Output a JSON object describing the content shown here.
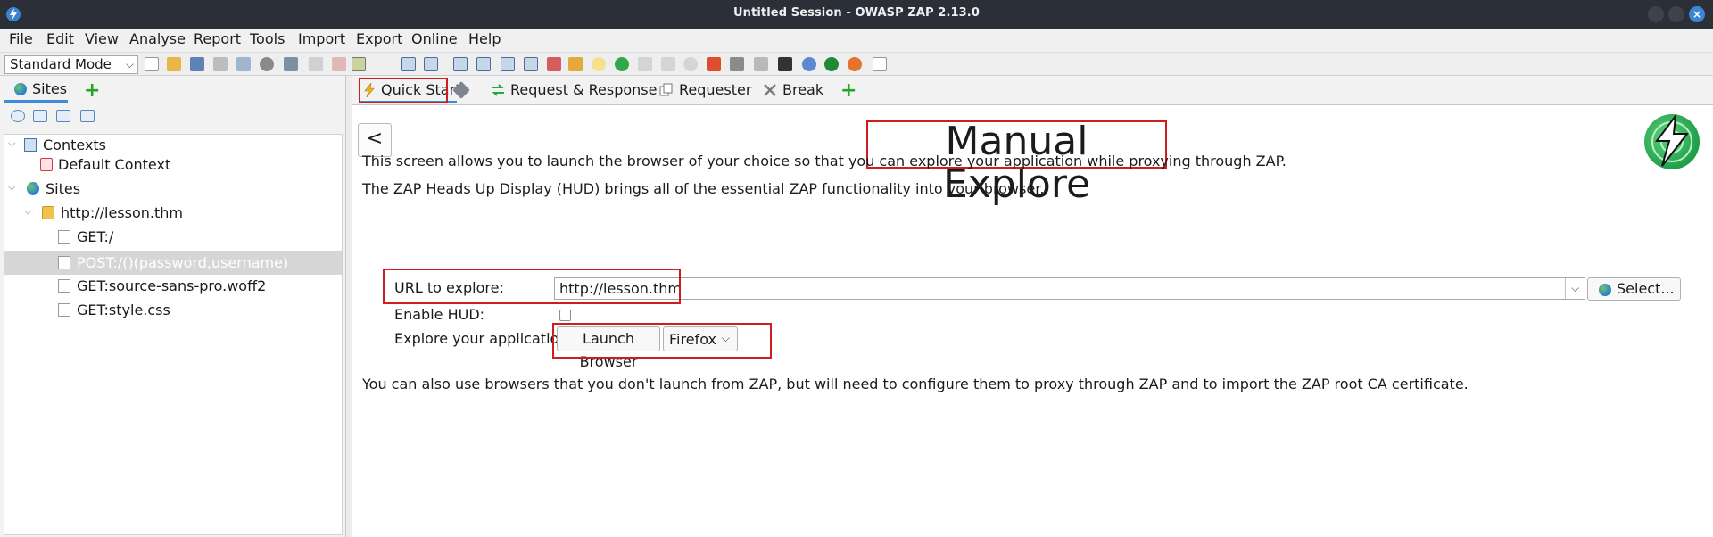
{
  "window": {
    "title": "Untitled Session - OWASP ZAP 2.13.0"
  },
  "menubar": [
    "File",
    "Edit",
    "View",
    "Analyse",
    "Report",
    "Tools",
    "Import",
    "Export",
    "Online",
    "Help"
  ],
  "toolbar": {
    "mode": "Standard Mode"
  },
  "left_panel": {
    "tab_label": "Sites",
    "tree": {
      "contexts_label": "Contexts",
      "default_context": "Default Context",
      "sites_label": "Sites",
      "site_host": "http://lesson.thm",
      "requests": [
        "GET:/",
        "POST:/()(password,username)",
        "GET:source-sans-pro.woff2",
        "GET:style.css"
      ],
      "selected_index": 1
    }
  },
  "tabs": [
    {
      "label": "Quick Start",
      "icon": "lightning-icon",
      "active": true
    },
    {
      "label": "Request & Response",
      "icon": "arrows-icon"
    },
    {
      "label": "Requester",
      "icon": "requester-icon"
    },
    {
      "label": "Break",
      "icon": "break-icon"
    }
  ],
  "content": {
    "back_label": "<",
    "heading": "Manual Explore",
    "para1": "This screen allows you to launch the browser of your choice so that you can explore your application while proxying through ZAP.",
    "para2": "The ZAP Heads Up Display (HUD) brings all of the essential ZAP functionality into your browser.",
    "url_label": "URL to explore:",
    "url_value": "http://lesson.thm",
    "select_label": "Select...",
    "hud_label": "Enable HUD:",
    "hud_checked": false,
    "explore_label": "Explore your application:",
    "launch_label": "Launch Browser",
    "browser_value": "Firefox",
    "para3": "You can also use browsers that you don't launch from ZAP, but will need to configure them to proxy through ZAP and to import the ZAP root CA certificate."
  },
  "colors": {
    "accent": "#3d8ad9",
    "highlight_box": "#d01c1c",
    "titlebar": "#2b2f37"
  }
}
